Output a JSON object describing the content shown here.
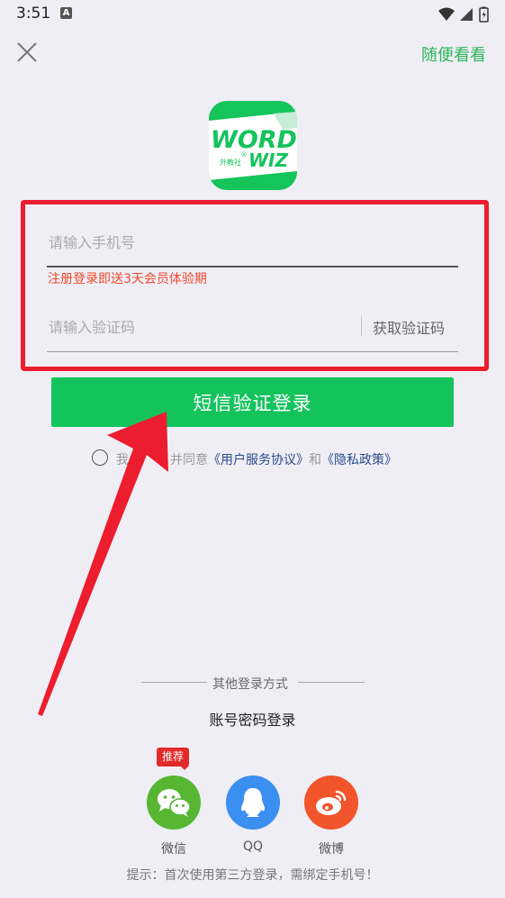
{
  "status_bar": {
    "time": "3:51",
    "notification_glyph": "A"
  },
  "header": {
    "skip_label": "随便看看"
  },
  "logo": {
    "line1": "WORD",
    "line2": "WIZ",
    "sub": "外教社",
    "mark": "®"
  },
  "form": {
    "phone_placeholder": "请输入手机号",
    "promo": "注册登录即送3天会员体验期",
    "code_placeholder": "请输入验证码",
    "get_code_label": "获取验证码"
  },
  "login_button": {
    "label": "短信验证登录"
  },
  "agreement": {
    "prefix": "我",
    "mid": "并同意",
    "terms_link": "《用户服务协议》",
    "and": "和",
    "privacy_link": "《隐私政策》"
  },
  "other_login": {
    "title": "其他登录方式",
    "password_login": "账号密码登录",
    "recommend_badge": "推荐",
    "providers": [
      {
        "label": "微信",
        "icon": "wechat-icon",
        "color": "#56b632"
      },
      {
        "label": "QQ",
        "icon": "qq-icon",
        "color": "#3a8ff0"
      },
      {
        "label": "微博",
        "icon": "weibo-icon",
        "color": "#f2552c"
      }
    ],
    "hint": "提示：首次使用第三方登录，需绑定手机号！"
  },
  "colors": {
    "accent": "#14c35c",
    "skip_link": "#2fb65a",
    "promo": "#ee4a2d",
    "annotation": "#ec1d2e",
    "background": "#efeef5"
  }
}
